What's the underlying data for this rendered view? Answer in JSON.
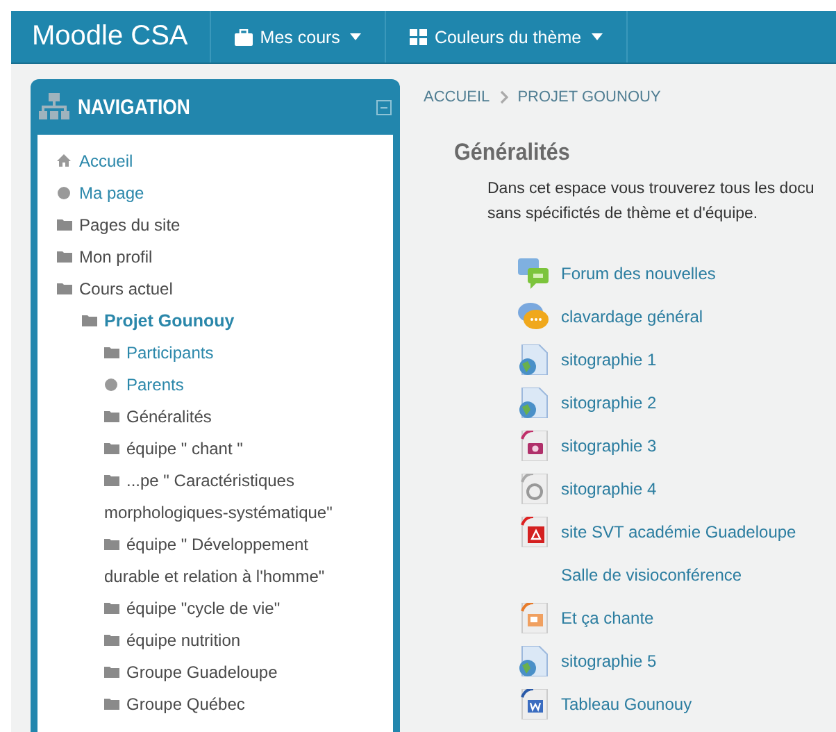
{
  "navbar": {
    "brand": "Moodle CSA",
    "menus": [
      {
        "label": "Mes cours",
        "kind": "briefcase"
      },
      {
        "label": "Couleurs du thème",
        "kind": "grid"
      }
    ]
  },
  "navigation": {
    "title": "NAVIGATION",
    "items": [
      {
        "label": "Accueil",
        "kind": "home",
        "link": true,
        "current": false
      },
      {
        "label": "Ma page",
        "kind": "circle",
        "link": true,
        "current": false
      },
      {
        "label": "Pages du site",
        "kind": "folder",
        "link": false,
        "current": false
      },
      {
        "label": "Mon profil",
        "kind": "folder",
        "link": false,
        "current": false
      },
      {
        "label": "Cours actuel",
        "kind": "folder",
        "link": false,
        "current": false,
        "children": [
          {
            "label": "Projet Gounouy",
            "kind": "folder",
            "link": true,
            "current": true,
            "children": [
              {
                "label": "Participants",
                "kind": "folder",
                "link": true,
                "current": false
              },
              {
                "label": "Parents",
                "kind": "circle",
                "link": true,
                "current": false
              },
              {
                "label": "Généralités",
                "kind": "folder",
                "link": false,
                "current": false
              },
              {
                "label": "équipe \" chant \"",
                "kind": "folder",
                "link": false,
                "current": false
              },
              {
                "label": "...pe \" Caractéristiques morphologiques-systématique\"",
                "kind": "folder",
                "link": false,
                "current": false
              },
              {
                "label": "équipe \" Développement durable et relation à l'homme\"",
                "kind": "folder",
                "link": false,
                "current": false
              },
              {
                "label": "équipe \"cycle de vie\"",
                "kind": "folder",
                "link": false,
                "current": false
              },
              {
                "label": "équipe nutrition",
                "kind": "folder",
                "link": false,
                "current": false
              },
              {
                "label": "Groupe Guadeloupe",
                "kind": "folder",
                "link": false,
                "current": false
              },
              {
                "label": "Groupe Québec",
                "kind": "folder",
                "link": false,
                "current": false
              }
            ]
          }
        ]
      }
    ]
  },
  "breadcrumb": [
    "ACCUEIL",
    "PROJET GOUNOUY"
  ],
  "section": {
    "title": "Généralités",
    "description": "Dans cet espace vous trouverez tous les docu sans spécifictés de thème et d'équipe.",
    "activities": [
      {
        "label": "Forum des nouvelles",
        "kind": "forum"
      },
      {
        "label": "clavardage général",
        "kind": "chat"
      },
      {
        "label": "sitographie 1",
        "kind": "url"
      },
      {
        "label": "sitographie 2",
        "kind": "url"
      },
      {
        "label": "sitographie 3",
        "kind": "image"
      },
      {
        "label": "sitographie 4",
        "kind": "file"
      },
      {
        "label": "site SVT académie Guadeloupe",
        "kind": "pdf"
      },
      {
        "label": "Salle de visioconférence",
        "kind": "none"
      },
      {
        "label": "Et ça chante",
        "kind": "slides"
      },
      {
        "label": "sitographie 5",
        "kind": "url"
      },
      {
        "label": "Tableau Gounouy",
        "kind": "doc"
      }
    ]
  }
}
